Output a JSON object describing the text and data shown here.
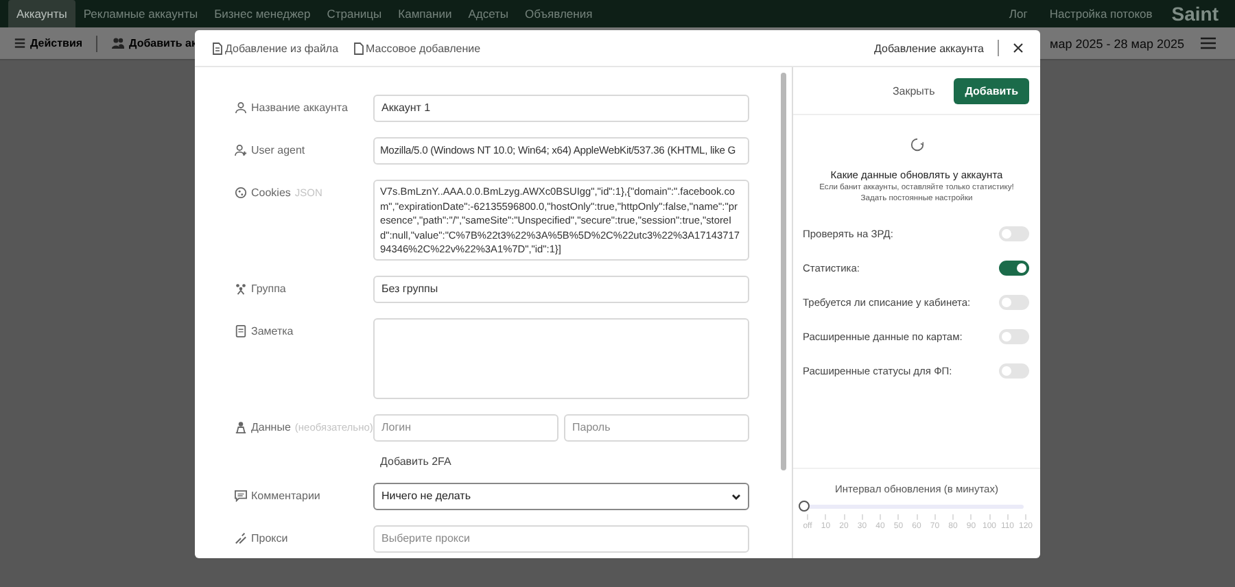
{
  "nav": {
    "tabs": [
      {
        "label": "Аккаунты",
        "selected": true
      },
      {
        "label": "Рекламные аккаунты",
        "selected": false
      },
      {
        "label": "Бизнес менеджер",
        "selected": false
      },
      {
        "label": "Страницы",
        "selected": false
      },
      {
        "label": "Кампании",
        "selected": false
      },
      {
        "label": "Адсеты",
        "selected": false
      },
      {
        "label": "Объявления",
        "selected": false
      }
    ],
    "links": [
      "Лог",
      "Настройка потоков"
    ],
    "logo": "Saint"
  },
  "toolbar": {
    "actions": "Действия",
    "add": "Добавить ак",
    "date_range": "мар 2025 - 28 мар 2025"
  },
  "modal": {
    "header_links": [
      "Добавление из файла",
      "Массовое добавление"
    ],
    "title": "Добавление аккаунта",
    "fields": [
      {
        "kind": "text",
        "label": "Название аккаунта",
        "value": "Аккаунт 1"
      },
      {
        "kind": "text",
        "label": "User agent",
        "value": "Mozilla/5.0 (Windows NT 10.0; Win64; x64) AppleWebKit/537.36 (KHTML, like G"
      },
      {
        "kind": "code",
        "label": "Cookies",
        "hint": "JSON",
        "value": "V7s.BmLznY..AAA.0.0.BmLzyg.AWXc0BSUIgg\",\"id\":1},{\"domain\":\".facebook.com\",\"expirationDate\":-62135596800.0,\"hostOnly\":true,\"httpOnly\":false,\"name\":\"presence\",\"path\":\"/\",\"sameSite\":\"Unspecified\",\"secure\":true,\"session\":true,\"storeId\":null,\"value\":\"C%7B%22t3%22%3A%5B%5D%2C%22utc3%22%3A1714371794346%2C%22v%22%3A1%7D\",\"id\":1}]"
      },
      {
        "kind": "text",
        "label": "Группа",
        "value": "Без группы"
      },
      {
        "kind": "area",
        "label": "Заметка"
      },
      {
        "kind": "pair",
        "label": "Данные",
        "hint": "(необязательно)",
        "placeholders": [
          "Логин",
          "Пароль"
        ],
        "link": "Добавить 2FA"
      },
      {
        "kind": "select",
        "label": "Комментарии",
        "value": "Ничего не делать"
      },
      {
        "kind": "text",
        "label": "Прокси",
        "placeholder": "Выберите прокси"
      }
    ],
    "buttons": {
      "close": "Закрыть",
      "add": "Добавить"
    },
    "update": {
      "title": "Какие данные обновлять у аккаунта",
      "note": "Если банит аккаунты, оставляйте только статистику!",
      "link": "Задать постоянные настройки"
    },
    "toggles": [
      {
        "label": "Проверять на ЗРД:",
        "on": false
      },
      {
        "label": "Статистика:",
        "on": true
      },
      {
        "label": "Требуется ли списание у кабинета:",
        "on": false
      },
      {
        "label": "Расширенные данные по картам:",
        "on": false
      },
      {
        "label": "Расширенные статусы для ФП:",
        "on": false
      }
    ],
    "interval": {
      "label": "Интервал обновления (в минутах)",
      "level": 0,
      "ticks": [
        "off",
        "10",
        "20",
        "30",
        "40",
        "50",
        "60",
        "70",
        "80",
        "90",
        "100",
        "110",
        "120"
      ]
    }
  }
}
